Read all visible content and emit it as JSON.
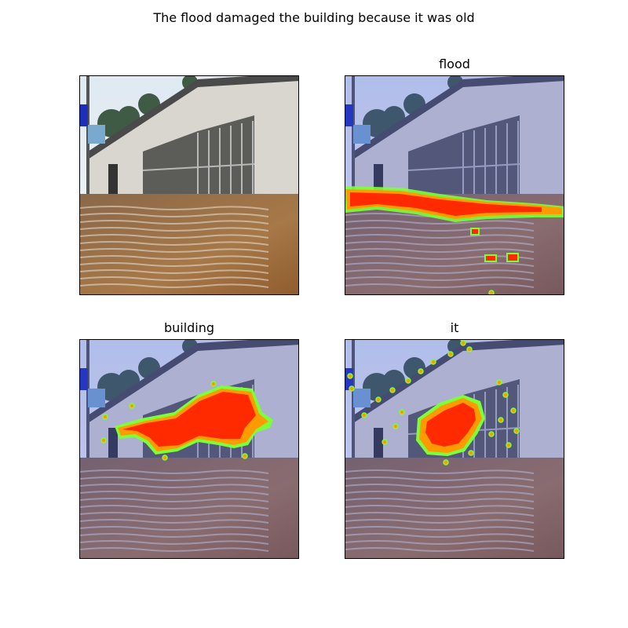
{
  "figure": {
    "title": "The flood damaged the building because it was old",
    "panels": [
      {
        "title": "",
        "overlay": "none"
      },
      {
        "title": "flood",
        "overlay": "flood"
      },
      {
        "title": "building",
        "overlay": "building"
      },
      {
        "title": "it",
        "overlay": "it"
      }
    ]
  },
  "colors": {
    "tint": "#3d4fd6",
    "hot": "#ff2a00",
    "warm": "#ff9a00",
    "edge": "#7cff3a"
  }
}
